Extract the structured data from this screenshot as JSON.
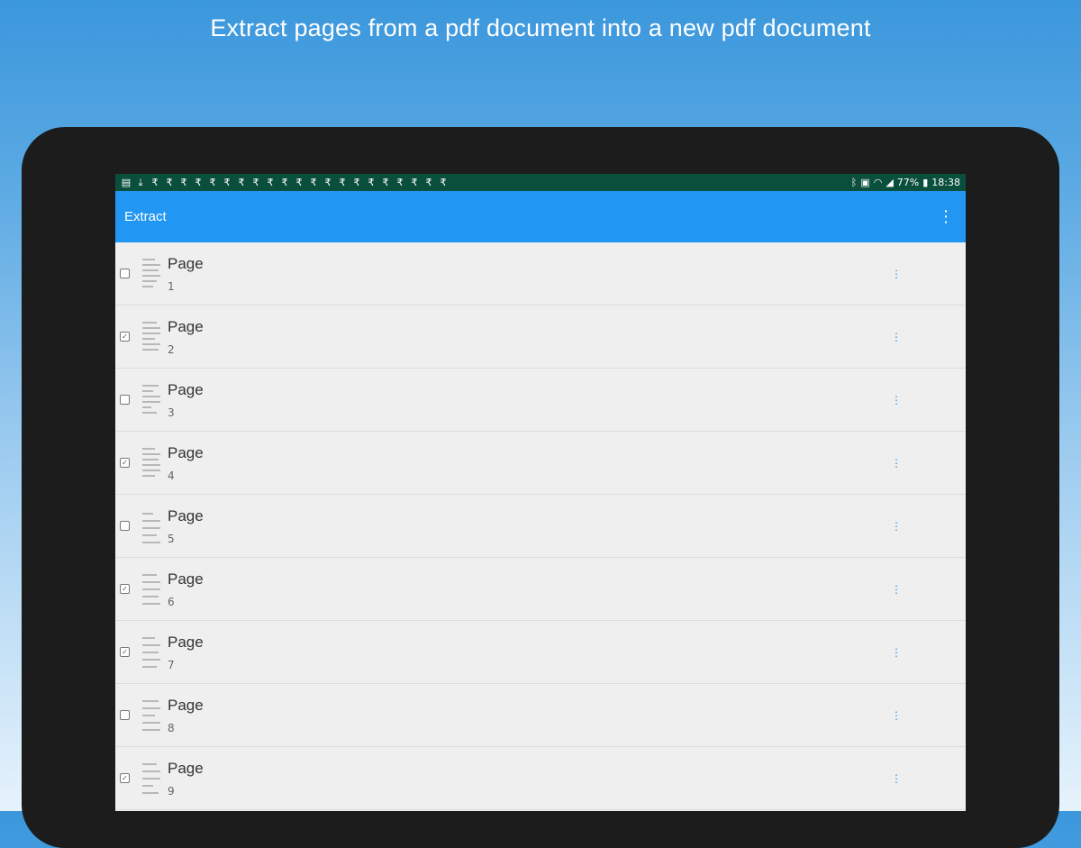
{
  "headline": "Extract pages from a pdf document into a new pdf document",
  "status_bar": {
    "left_icons": [
      "file-icon",
      "download-icon",
      "rupee-icon",
      "rupee-icon",
      "rupee-icon",
      "rupee-icon",
      "rupee-icon",
      "rupee-icon",
      "rupee-icon",
      "rupee-icon",
      "rupee-icon",
      "rupee-icon",
      "rupee-icon",
      "rupee-icon",
      "rupee-icon",
      "rupee-icon",
      "rupee-icon",
      "rupee-icon",
      "rupee-icon",
      "rupee-icon",
      "rupee-icon",
      "rupee-icon",
      "rupee-icon"
    ],
    "battery": "77%",
    "time": "18:38"
  },
  "app_bar": {
    "title": "Extract",
    "menu_icon": "more-vert-icon"
  },
  "colors": {
    "app_bar": "#2196f3",
    "status_bar": "#0a4f3c",
    "list_bg": "#efefef",
    "tablet_frame": "#1c1c1c"
  },
  "pages": [
    {
      "label": "Page",
      "number": "1",
      "checked": false
    },
    {
      "label": "Page",
      "number": "2",
      "checked": true
    },
    {
      "label": "Page",
      "number": "3",
      "checked": false
    },
    {
      "label": "Page",
      "number": "4",
      "checked": true
    },
    {
      "label": "Page",
      "number": "5",
      "checked": false
    },
    {
      "label": "Page",
      "number": "6",
      "checked": true
    },
    {
      "label": "Page",
      "number": "7",
      "checked": true
    },
    {
      "label": "Page",
      "number": "8",
      "checked": false
    },
    {
      "label": "Page",
      "number": "9",
      "checked": true
    }
  ]
}
